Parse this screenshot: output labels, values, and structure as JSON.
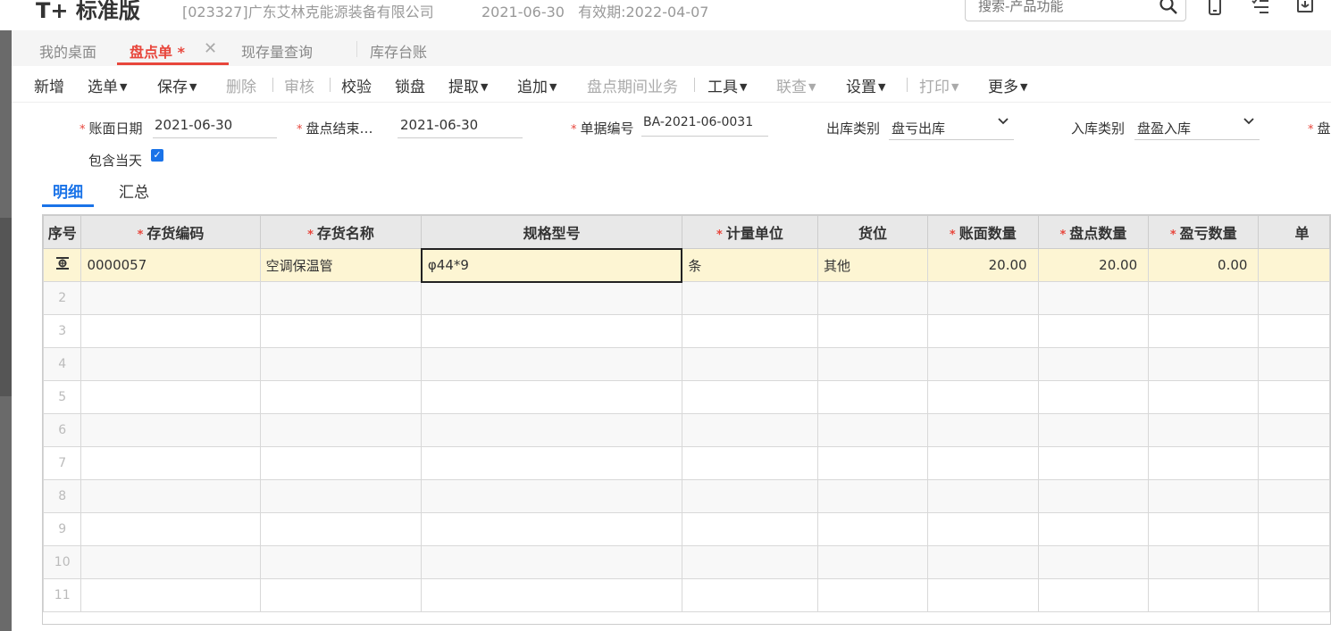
{
  "header": {
    "logo": "T+ 标准版",
    "company": "[023327]广东艾林克能源装备有限公司",
    "date": "2021-06-30",
    "validity": "有效期:2022-04-07",
    "search_placeholder": "搜索-产品功能"
  },
  "tabs": [
    {
      "label": "我的桌面"
    },
    {
      "label": "盘点单 *"
    },
    {
      "label": "现存量查询"
    },
    {
      "label": "库存台账"
    }
  ],
  "toolbar": {
    "new": "新增",
    "select": "选单",
    "save": "保存",
    "delete": "删除",
    "audit": "审核",
    "verify": "校验",
    "lock": "锁盘",
    "extract": "提取",
    "append": "追加",
    "period": "盘点期间业务",
    "tools": "工具",
    "query": "联查",
    "settings": "设置",
    "print": "打印",
    "more": "更多"
  },
  "form": {
    "book_date_label": "账面日期",
    "book_date": "2021-06-30",
    "end_label": "盘点结束…",
    "end_date": "2021-06-30",
    "doc_no_label": "单据编号",
    "doc_no": "BA-2021-06-0031",
    "out_type_label": "出库类别",
    "out_type": "盘亏出库",
    "in_type_label": "入库类别",
    "in_type": "盘盈入库",
    "cut_label": "盘",
    "include_today_label": "包含当天"
  },
  "subtabs": [
    "明细",
    "汇总"
  ],
  "table": {
    "columns": [
      "序号",
      "存货编码",
      "存货名称",
      "规格型号",
      "计量单位",
      "货位",
      "账面数量",
      "盘点数量",
      "盈亏数量",
      "单"
    ],
    "required": [
      false,
      true,
      true,
      false,
      true,
      false,
      true,
      true,
      true,
      false
    ],
    "rows": [
      {
        "idx": "",
        "code": "0000057",
        "name": "空调保温管",
        "spec": "φ44*9",
        "unit": "条",
        "loc": "其他",
        "book_qty": "20.00",
        "count_qty": "20.00",
        "diff_qty": "0.00"
      },
      {
        "idx": "2"
      },
      {
        "idx": "3"
      },
      {
        "idx": "4"
      },
      {
        "idx": "5"
      },
      {
        "idx": "6"
      },
      {
        "idx": "7"
      },
      {
        "idx": "8"
      },
      {
        "idx": "9"
      },
      {
        "idx": "10"
      },
      {
        "idx": "11"
      }
    ]
  }
}
